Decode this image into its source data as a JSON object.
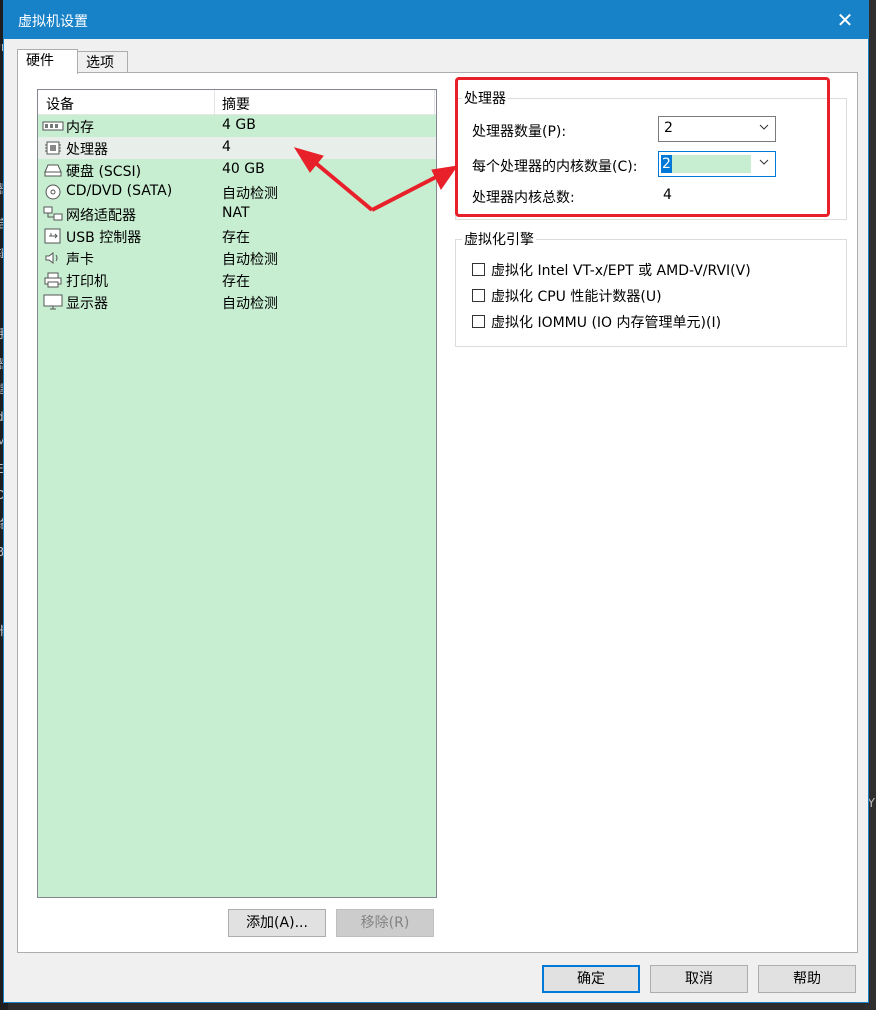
{
  "window": {
    "title": "虚拟机设置",
    "close_glyph": "✕"
  },
  "tabs": [
    {
      "label": "硬件"
    },
    {
      "label": "选项"
    }
  ],
  "device_list": {
    "col_device": "设备",
    "col_summary": "摘要",
    "items": [
      {
        "name": "内存",
        "summary": "4 GB",
        "icon": "memory-icon"
      },
      {
        "name": "处理器",
        "summary": "4",
        "icon": "processor-icon"
      },
      {
        "name": "硬盘 (SCSI)",
        "summary": "40 GB",
        "icon": "harddisk-icon"
      },
      {
        "name": "CD/DVD (SATA)",
        "summary": "自动检测",
        "icon": "cdrom-icon"
      },
      {
        "name": "网络适配器",
        "summary": "NAT",
        "icon": "network-icon"
      },
      {
        "name": "USB 控制器",
        "summary": "存在",
        "icon": "usb-icon"
      },
      {
        "name": "声卡",
        "summary": "自动检测",
        "icon": "sound-icon"
      },
      {
        "name": "打印机",
        "summary": "存在",
        "icon": "printer-icon"
      },
      {
        "name": "显示器",
        "summary": "自动检测",
        "icon": "display-icon"
      }
    ],
    "selected_index": 1
  },
  "buttons": {
    "add": "添加(A)...",
    "remove": "移除(R)",
    "ok": "确定",
    "cancel": "取消",
    "help": "帮助"
  },
  "processor": {
    "group_title": "处理器",
    "count_label": "处理器数量(P):",
    "count_value": "2",
    "cores_label": "每个处理器的内核数量(C):",
    "cores_value": "2",
    "total_label": "处理器内核总数:",
    "total_value": "4"
  },
  "virtualization": {
    "group_title": "虚拟化引擎",
    "options": [
      {
        "label": "虚拟化 Intel VT-x/EPT 或 AMD-V/RVI(V)",
        "checked": false
      },
      {
        "label": "虚拟化 CPU 性能计数器(U)",
        "checked": false
      },
      {
        "label": "虚拟化 IOMMU (IO 内存管理单元)(I)",
        "checked": false
      }
    ]
  },
  "background_fragments": [
    "ᵉr",
    "器",
    "启",
    "辑",
    "手",
    "器",
    "建",
    "dl",
    "M",
    "E",
    "D",
    "络",
    "B",
    "卡",
    "机",
    "示器",
    "建",
    "Y"
  ],
  "colors": {
    "titlebar": "#1882c8",
    "list_bg": "#c8eed2",
    "annotation": "#e8202a",
    "focus": "#0078d7"
  }
}
